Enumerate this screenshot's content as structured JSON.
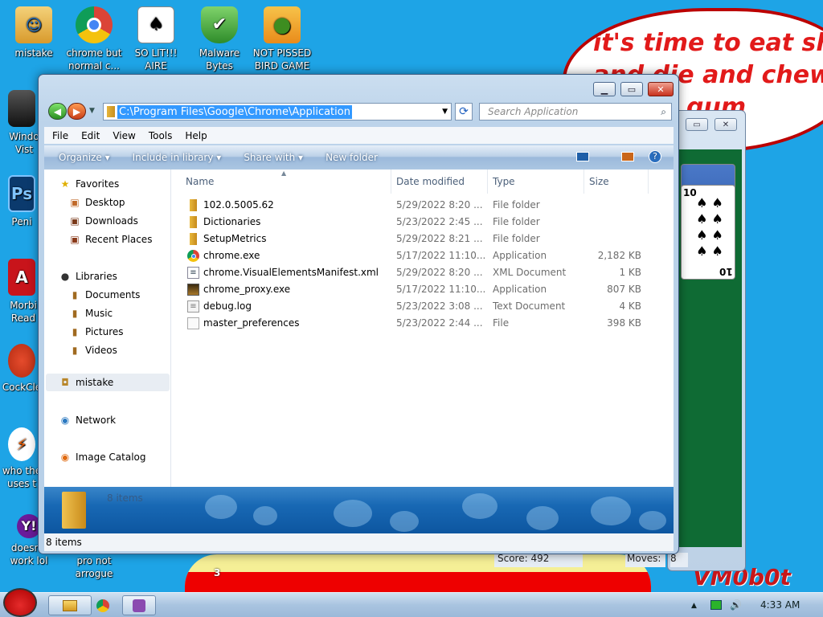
{
  "desktop": {
    "icons": [
      {
        "label": "mistake",
        "icon": "user-folder-icon"
      },
      {
        "label": "chrome but normal c...",
        "icon": "chrome-icon"
      },
      {
        "label": "SO LIT!!! AIRE",
        "icon": "cards-icon"
      },
      {
        "label": "Malware Bytes",
        "icon": "shield-icon"
      },
      {
        "label": "NOT PISSED BIRD GAME",
        "icon": "pig-icon"
      }
    ],
    "left_icons": [
      {
        "label": "Windo Vist",
        "icon": "trash-icon"
      },
      {
        "label": "Peni",
        "icon": "photoshop-icon"
      },
      {
        "label": "Morbi Read",
        "icon": "pdf-icon"
      },
      {
        "label": "CockCle",
        "icon": "ccleaner-icon"
      },
      {
        "label": "who the uses t",
        "icon": "flash-icon"
      },
      {
        "label": "doesn't work lol",
        "icon": "yahoo-icon"
      },
      {
        "label": "pro not arrogue",
        "icon": "app-icon"
      }
    ],
    "speech_lines": [
      "it's time to eat shit",
      "and die and chew",
      "gum"
    ],
    "mascot_number": "3",
    "watermark": "VM0b0t"
  },
  "solitaire": {
    "score_label": "Score: 492",
    "moves_label": "Moves:",
    "moves_value": "8",
    "card_ranks": [
      "10",
      "10"
    ],
    "suit_glyph": "♠"
  },
  "explorer": {
    "address": "C:\\Program Files\\Google\\Chrome\\Application",
    "search_placeholder": "Search Application",
    "menu": [
      "File",
      "Edit",
      "View",
      "Tools",
      "Help"
    ],
    "commands": [
      "Organize ▾",
      "Include in library ▾",
      "Share with ▾",
      "New folder"
    ],
    "nav": {
      "favorites": "Favorites",
      "favorites_items": [
        "Desktop",
        "Downloads",
        "Recent Places"
      ],
      "libraries": "Libraries",
      "libraries_items": [
        "Documents",
        "Music",
        "Pictures",
        "Videos"
      ],
      "user": "mistake",
      "network": "Network",
      "image_catalog": "Image Catalog"
    },
    "columns": [
      "Name",
      "Date modified",
      "Type",
      "Size"
    ],
    "files": [
      {
        "name": "102.0.5005.62",
        "date": "5/29/2022 8:20 ...",
        "type": "File folder",
        "size": "",
        "icon": "folder-icon"
      },
      {
        "name": "Dictionaries",
        "date": "5/23/2022 2:45 ...",
        "type": "File folder",
        "size": "",
        "icon": "folder-icon"
      },
      {
        "name": "SetupMetrics",
        "date": "5/29/2022 8:21 ...",
        "type": "File folder",
        "size": "",
        "icon": "folder-icon"
      },
      {
        "name": "chrome.exe",
        "date": "5/17/2022 11:10...",
        "type": "Application",
        "size": "2,182 KB",
        "icon": "chrome-icon"
      },
      {
        "name": "chrome.VisualElementsManifest.xml",
        "date": "5/29/2022 8:20 ...",
        "type": "XML Document",
        "size": "1 KB",
        "icon": "xml-file-icon"
      },
      {
        "name": "chrome_proxy.exe",
        "date": "5/17/2022 11:10...",
        "type": "Application",
        "size": "807 KB",
        "icon": "exe-icon"
      },
      {
        "name": "debug.log",
        "date": "5/23/2022 3:08 ...",
        "type": "Text Document",
        "size": "4 KB",
        "icon": "text-file-icon"
      },
      {
        "name": "master_preferences",
        "date": "5/23/2022 2:44 ...",
        "type": "File",
        "size": "398 KB",
        "icon": "file-icon"
      }
    ],
    "details_count": "8 items",
    "status_count": "8 items"
  },
  "taskbar": {
    "clock": "4:33 AM"
  }
}
